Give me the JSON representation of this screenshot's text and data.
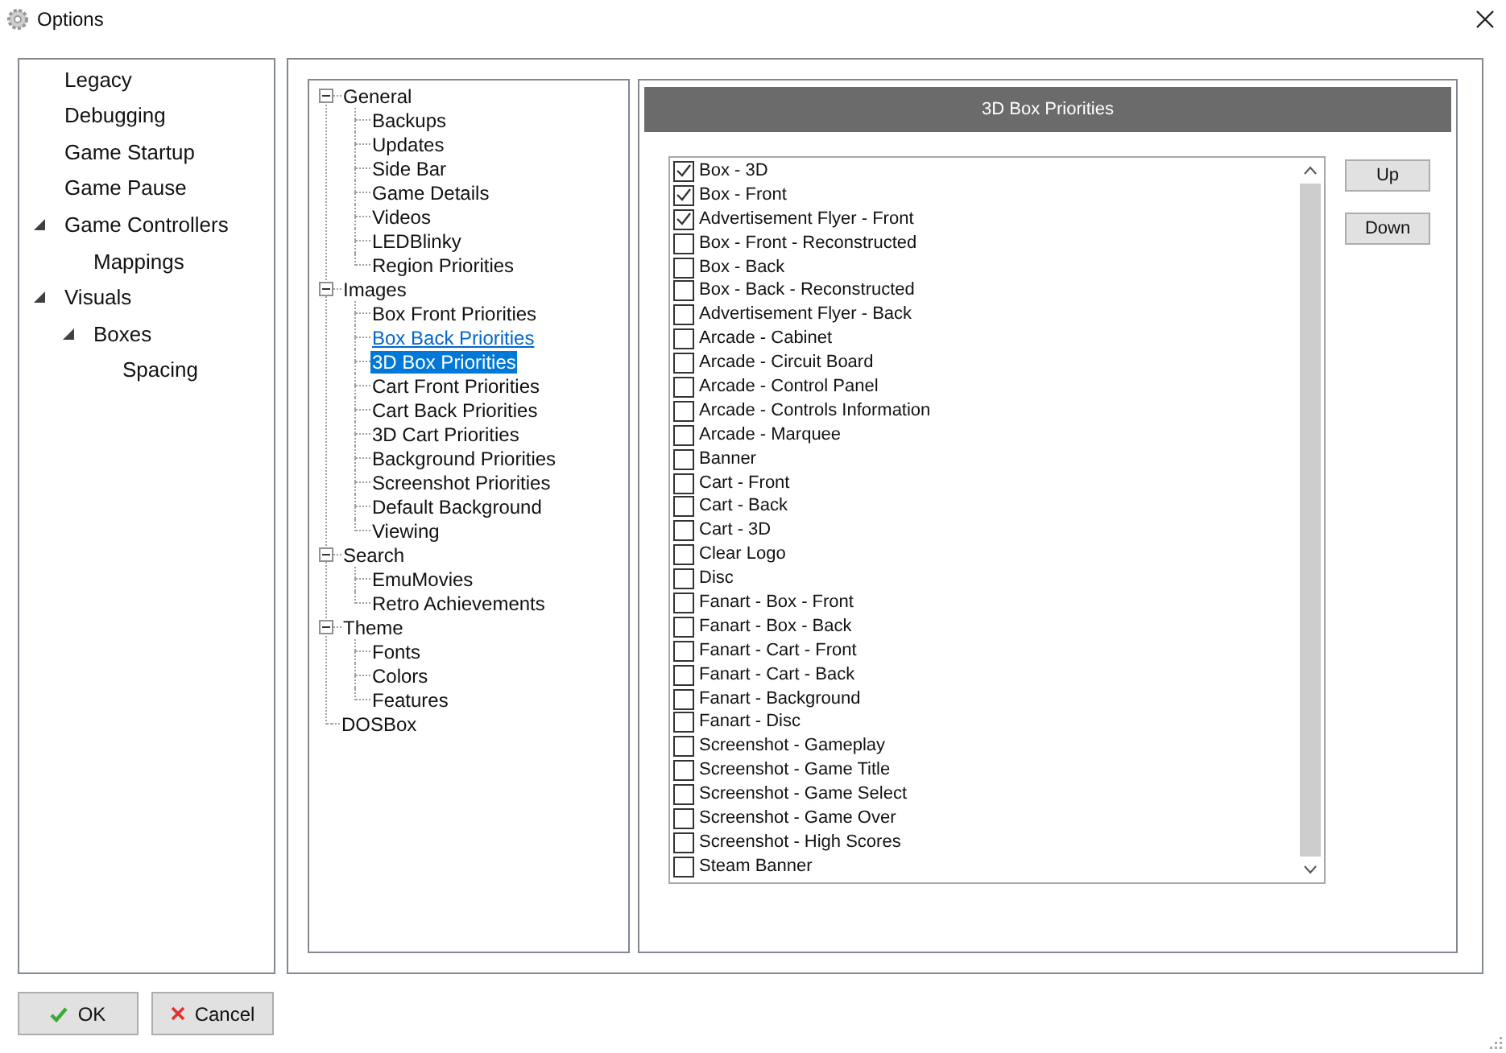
{
  "window": {
    "title": "Options"
  },
  "sidebar": {
    "items": [
      {
        "label": "Legacy",
        "selected": false
      },
      {
        "label": "Debugging",
        "selected": false
      },
      {
        "label": "Game Startup",
        "selected": false
      },
      {
        "label": "Game Pause",
        "selected": false
      },
      {
        "label": "Game Controllers",
        "selected": false,
        "expanded": true,
        "children": [
          {
            "label": "Mappings",
            "selected": false
          }
        ]
      },
      {
        "label": "Visuals",
        "selected": false,
        "expanded": true,
        "children": [
          {
            "label": "Boxes",
            "selected": false,
            "expanded": true,
            "children": [
              {
                "label": "Spacing",
                "selected": false
              }
            ]
          }
        ]
      }
    ]
  },
  "tree": [
    {
      "label": "General",
      "expanded": true,
      "children": [
        {
          "label": "Backups",
          "selected": false,
          "hovered": false
        },
        {
          "label": "Updates",
          "selected": false,
          "hovered": false
        },
        {
          "label": "Side Bar",
          "selected": false,
          "hovered": false
        },
        {
          "label": "Game Details",
          "selected": false,
          "hovered": false
        },
        {
          "label": "Videos",
          "selected": false,
          "hovered": false
        },
        {
          "label": "LEDBlinky",
          "selected": false,
          "hovered": false
        },
        {
          "label": "Region Priorities",
          "selected": false,
          "hovered": false
        }
      ]
    },
    {
      "label": "Images",
      "expanded": true,
      "children": [
        {
          "label": "Box Front Priorities",
          "selected": false,
          "hovered": false
        },
        {
          "label": "Box Back Priorities",
          "selected": false,
          "hovered": true
        },
        {
          "label": "3D Box Priorities",
          "selected": true,
          "hovered": false
        },
        {
          "label": "Cart Front Priorities",
          "selected": false,
          "hovered": false
        },
        {
          "label": "Cart Back Priorities",
          "selected": false,
          "hovered": false
        },
        {
          "label": "3D Cart Priorities",
          "selected": false,
          "hovered": false
        },
        {
          "label": "Background Priorities",
          "selected": false,
          "hovered": false
        },
        {
          "label": "Screenshot Priorities",
          "selected": false,
          "hovered": false
        },
        {
          "label": "Default Background",
          "selected": false,
          "hovered": false
        },
        {
          "label": "Viewing",
          "selected": false,
          "hovered": false
        }
      ]
    },
    {
      "label": "Search",
      "expanded": true,
      "children": [
        {
          "label": "EmuMovies",
          "selected": false,
          "hovered": false
        },
        {
          "label": "Retro Achievements",
          "selected": false,
          "hovered": false
        }
      ]
    },
    {
      "label": "Theme",
      "expanded": true,
      "children": [
        {
          "label": "Fonts",
          "selected": false,
          "hovered": false
        },
        {
          "label": "Colors",
          "selected": false,
          "hovered": false
        },
        {
          "label": "Features",
          "selected": false,
          "hovered": false
        }
      ]
    },
    {
      "label": "DOSBox"
    }
  ],
  "panel": {
    "title": "3D Box Priorities",
    "items": [
      {
        "label": "Box - 3D",
        "checked": true
      },
      {
        "label": "Box - Front",
        "checked": true
      },
      {
        "label": "Advertisement Flyer - Front",
        "checked": true
      },
      {
        "label": "Box - Front - Reconstructed",
        "checked": false
      },
      {
        "label": "Box - Back",
        "checked": false
      },
      {
        "label": "Box - Back - Reconstructed",
        "checked": false
      },
      {
        "label": "Advertisement Flyer - Back",
        "checked": false
      },
      {
        "label": "Arcade - Cabinet",
        "checked": false
      },
      {
        "label": "Arcade - Circuit Board",
        "checked": false
      },
      {
        "label": "Arcade - Control Panel",
        "checked": false
      },
      {
        "label": "Arcade - Controls Information",
        "checked": false
      },
      {
        "label": "Arcade - Marquee",
        "checked": false
      },
      {
        "label": "Banner",
        "checked": false
      },
      {
        "label": "Cart - Front",
        "checked": false
      },
      {
        "label": "Cart - Back",
        "checked": false
      },
      {
        "label": "Cart - 3D",
        "checked": false
      },
      {
        "label": "Clear Logo",
        "checked": false
      },
      {
        "label": "Disc",
        "checked": false
      },
      {
        "label": "Fanart - Box - Front",
        "checked": false
      },
      {
        "label": "Fanart - Box - Back",
        "checked": false
      },
      {
        "label": "Fanart - Cart - Front",
        "checked": false
      },
      {
        "label": "Fanart - Cart - Back",
        "checked": false
      },
      {
        "label": "Fanart - Background",
        "checked": false
      },
      {
        "label": "Fanart - Disc",
        "checked": false
      },
      {
        "label": "Screenshot - Gameplay",
        "checked": false
      },
      {
        "label": "Screenshot - Game Title",
        "checked": false
      },
      {
        "label": "Screenshot - Game Select",
        "checked": false
      },
      {
        "label": "Screenshot - Game Over",
        "checked": false
      },
      {
        "label": "Screenshot - High Scores",
        "checked": false
      },
      {
        "label": "Steam Banner",
        "checked": false
      }
    ],
    "buttons": [
      "Up",
      "Down"
    ]
  },
  "footer": {
    "ok": "OK",
    "cancel": "Cancel"
  }
}
